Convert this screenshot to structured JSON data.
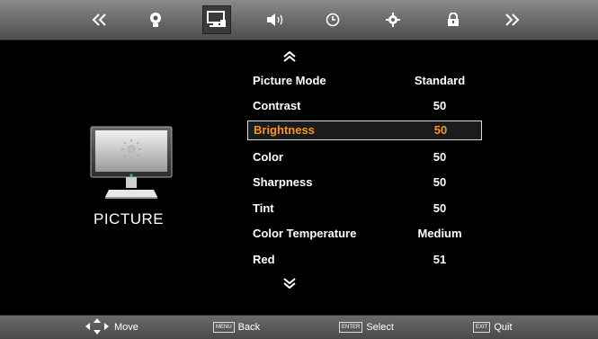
{
  "menu_bar": {
    "tabs": [
      {
        "icon": "double-chevron-left-icon"
      },
      {
        "icon": "channel-icon"
      },
      {
        "icon": "picture-icon",
        "active": true
      },
      {
        "icon": "sound-icon"
      },
      {
        "icon": "time-icon"
      },
      {
        "icon": "setup-icon"
      },
      {
        "icon": "lock-icon"
      },
      {
        "icon": "double-chevron-right-icon"
      }
    ]
  },
  "sidebar": {
    "title": "PICTURE",
    "icon": "monitor-icon"
  },
  "picture_menu": {
    "items": [
      {
        "label": "Picture Mode",
        "value": "Standard"
      },
      {
        "label": "Contrast",
        "value": "50"
      },
      {
        "label": "Brightness",
        "value": "50",
        "selected": true
      },
      {
        "label": "Color",
        "value": "50"
      },
      {
        "label": "Sharpness",
        "value": "50"
      },
      {
        "label": "Tint",
        "value": "50"
      },
      {
        "label": "Color Temperature",
        "value": "Medium"
      },
      {
        "label": "Red",
        "value": "51"
      }
    ]
  },
  "footer": {
    "move": {
      "label": "Move",
      "icon": "dpad-icon"
    },
    "back": {
      "key": "MENU",
      "label": "Back"
    },
    "select": {
      "key": "ENTER",
      "label": "Select"
    },
    "quit": {
      "key": "EXIT",
      "label": "Quit"
    }
  },
  "colors": {
    "highlight": "#f7941d",
    "bar": "#6e6e6e",
    "background": "#000000"
  }
}
